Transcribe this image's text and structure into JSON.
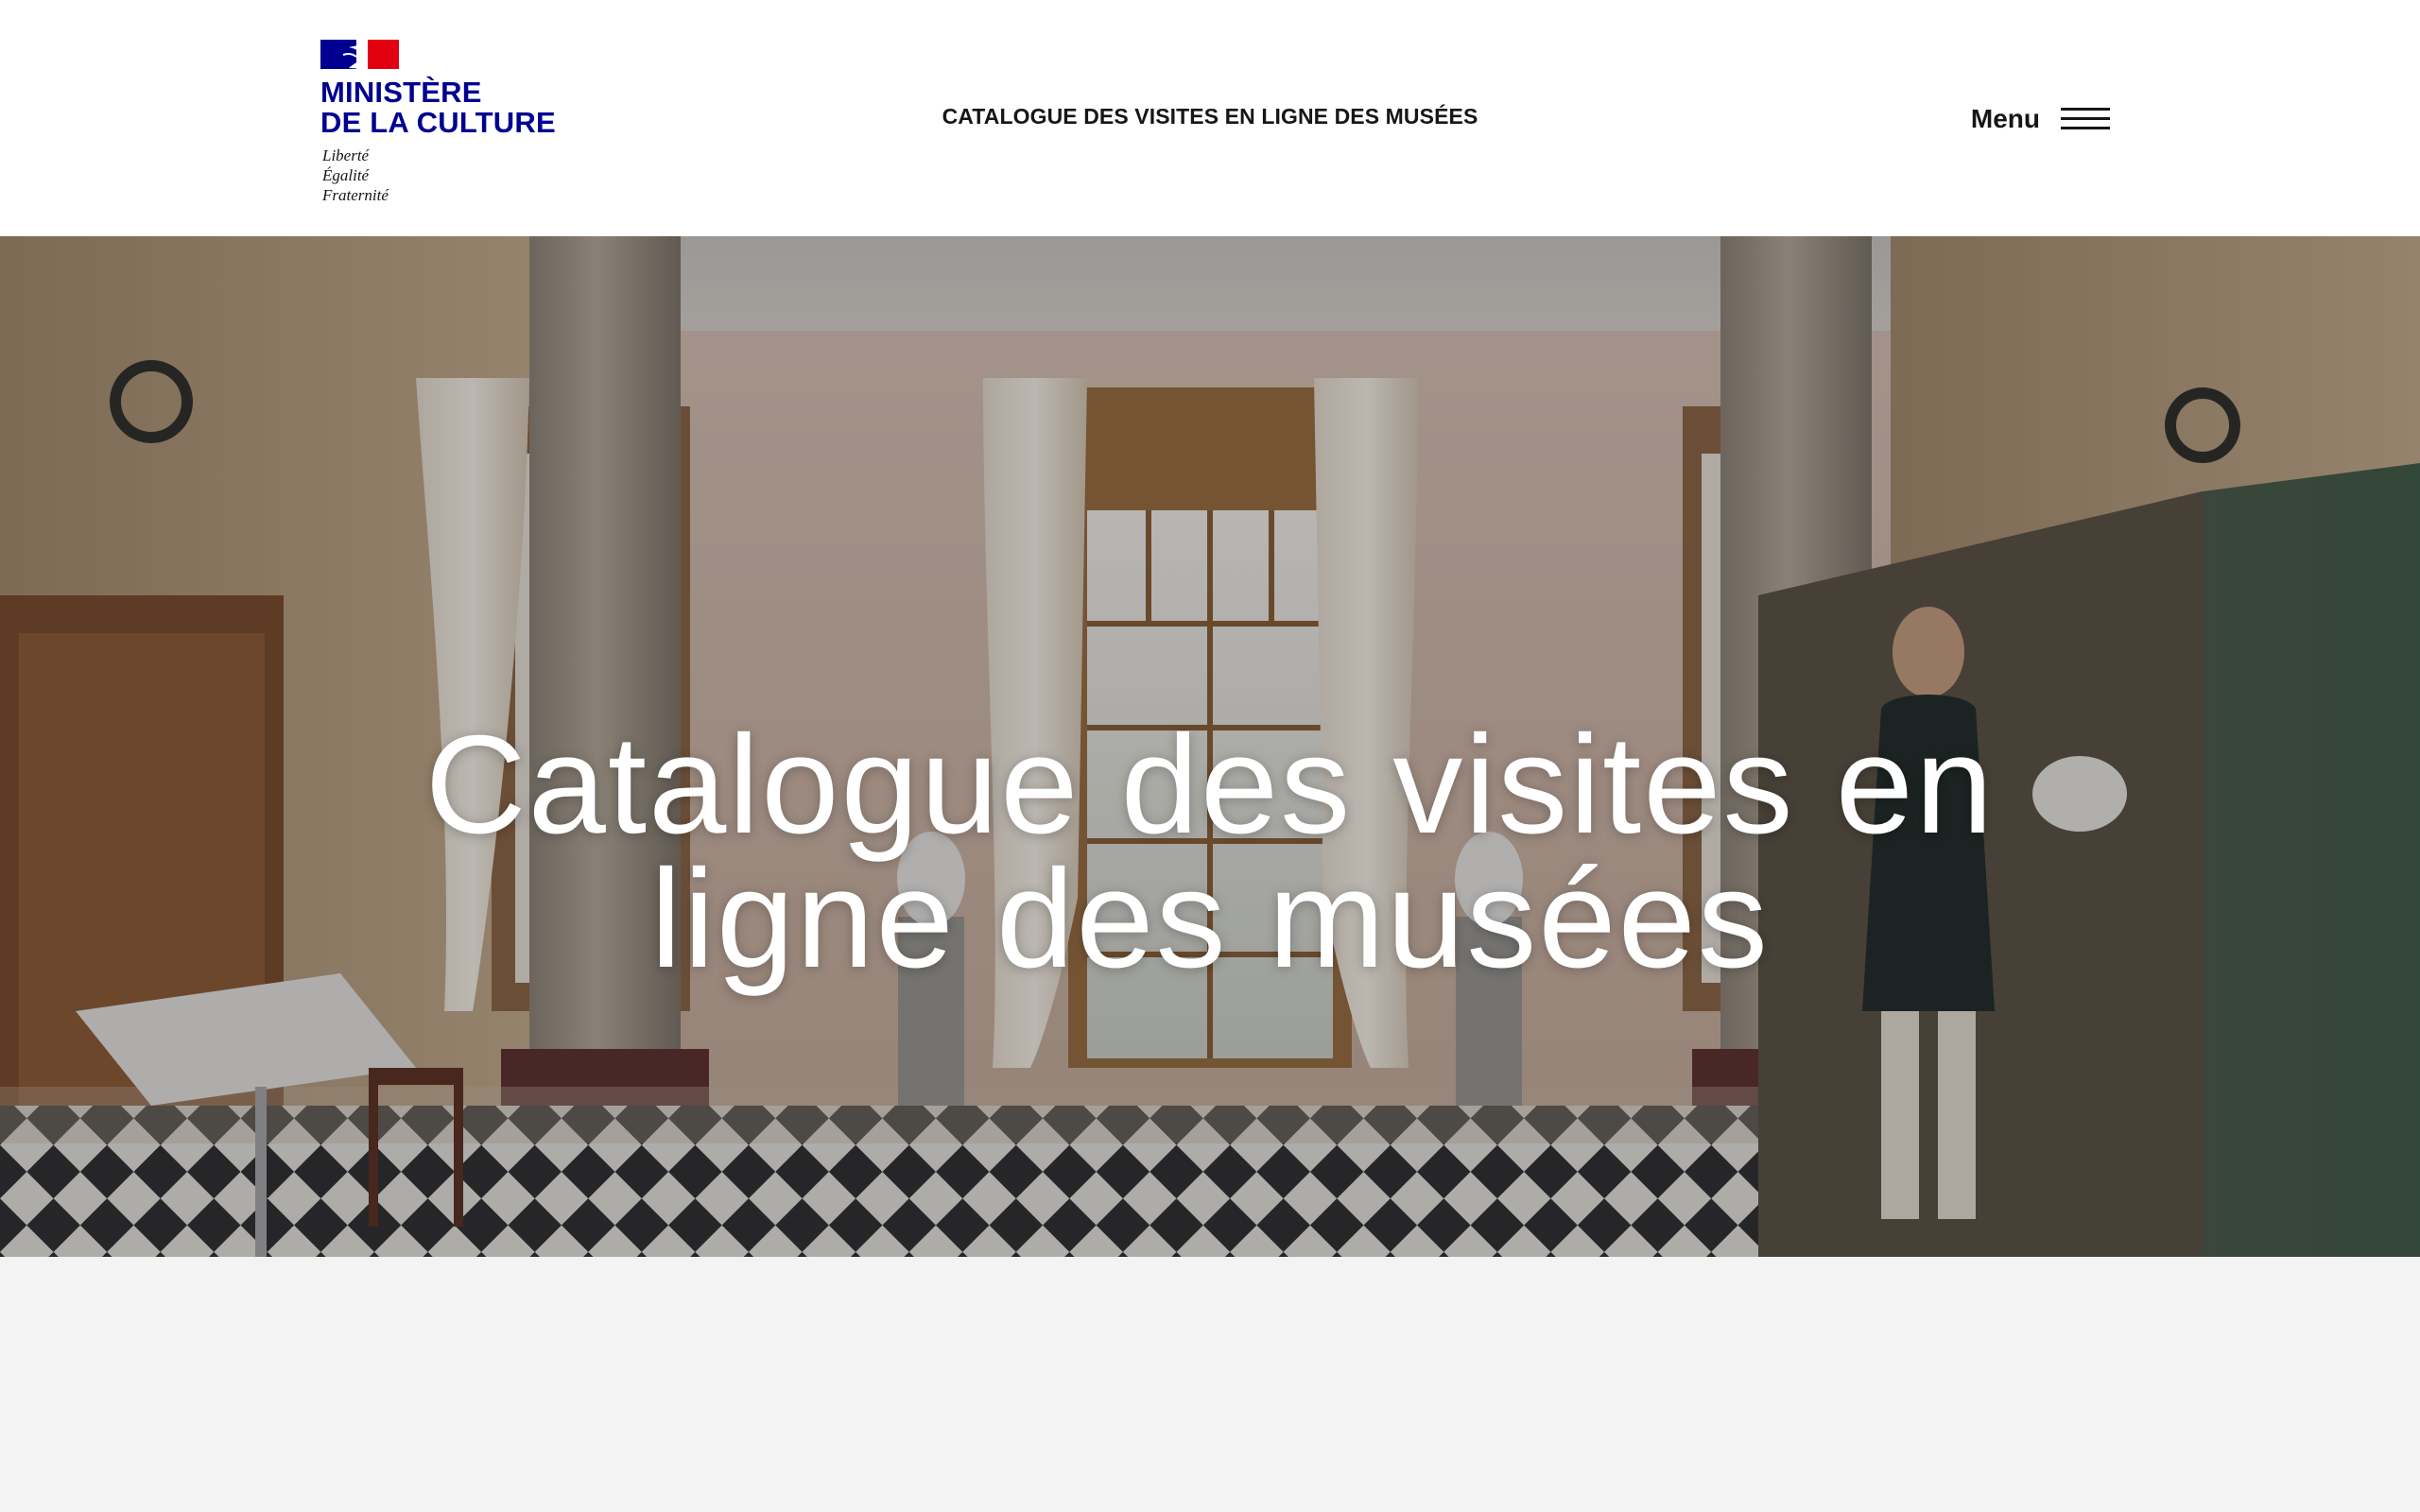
{
  "header": {
    "logo": {
      "title_line1": "MINISTÈRE",
      "title_line2": "DE LA CULTURE",
      "motto": [
        "Liberté",
        "Égalité",
        "Fraternité"
      ]
    },
    "site_title": "CATALOGUE DES VISITES EN LIGNE DES MUSÉES",
    "menu_label": "Menu",
    "menu_icon": "hamburger-menu-icon"
  },
  "hero": {
    "title": "Catalogue des visites en ligne des musées",
    "image_subject": "museum hall with columns, curtains, checkered marble floor and portrait exhibition panel"
  },
  "colors": {
    "brand_blue": "#000091",
    "brand_red": "#e1000f",
    "text": "#161616",
    "header_bg": "#ffffff",
    "page_bg": "#f3f3f3"
  }
}
